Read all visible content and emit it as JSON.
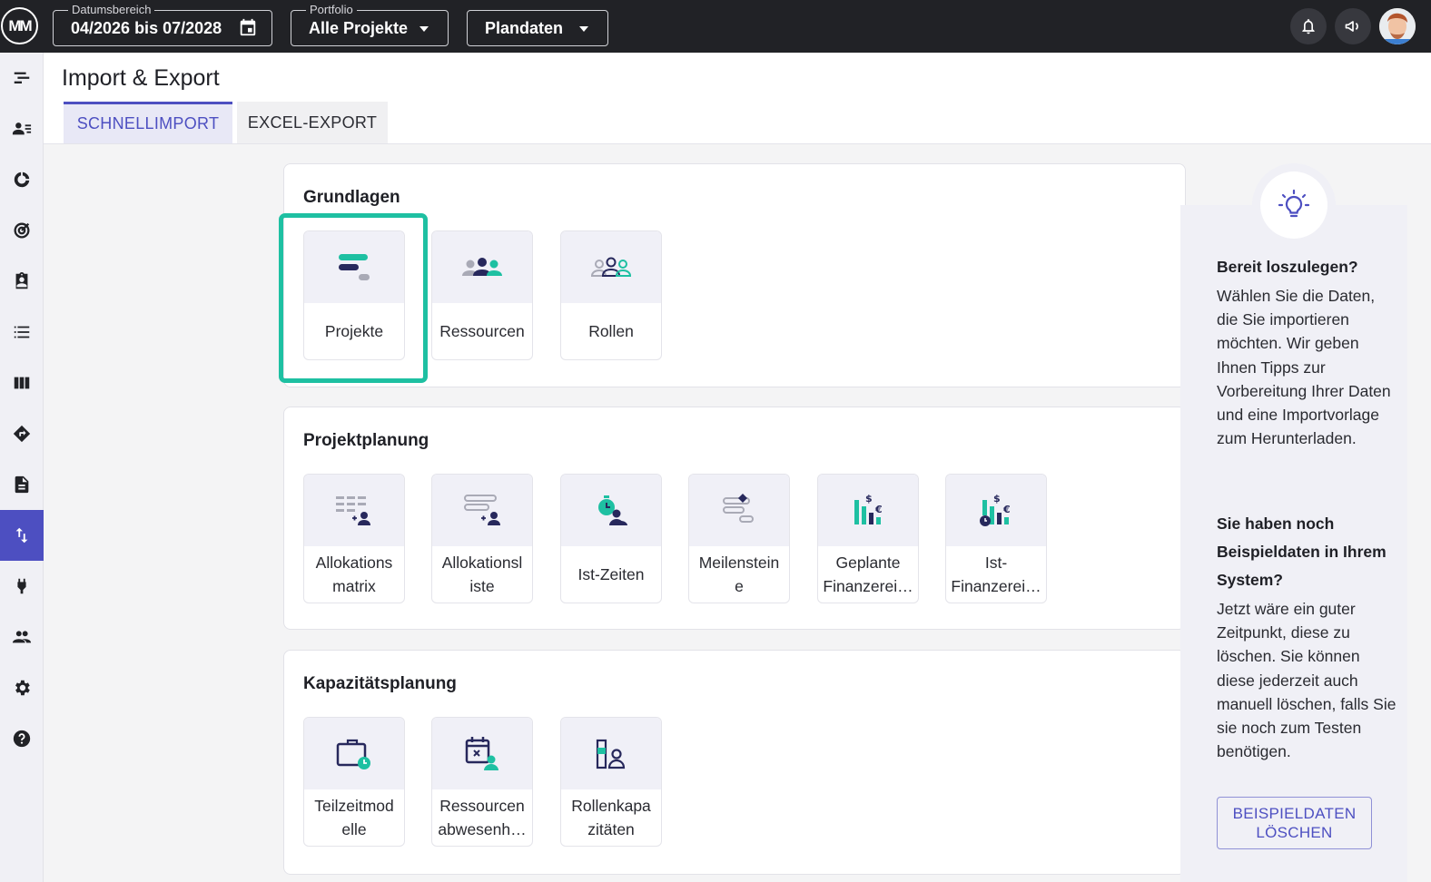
{
  "colors": {
    "accent": "#4d4fc1",
    "teal": "#1ec0a2",
    "navy": "#27285c",
    "topbar": "#212226"
  },
  "topbar": {
    "logo_text": "MM",
    "date_range": {
      "legend": "Datumsbereich",
      "value": "04/2026 bis 07/2028"
    },
    "portfolio": {
      "legend": "Portfolio",
      "value": "Alle Projekte"
    },
    "data_type": {
      "value": "Plandaten"
    }
  },
  "sidebar": {
    "items": [
      {
        "icon": "gantt-icon"
      },
      {
        "icon": "resource-list-icon"
      },
      {
        "icon": "pie-chart-icon"
      },
      {
        "icon": "target-icon"
      },
      {
        "icon": "clipboard-person-icon"
      },
      {
        "icon": "list-icon"
      },
      {
        "icon": "columns-icon"
      },
      {
        "icon": "direction-sign-icon"
      },
      {
        "icon": "document-icon"
      },
      {
        "icon": "import-export-icon",
        "active": true
      },
      {
        "icon": "plug-icon"
      },
      {
        "icon": "people-icon"
      },
      {
        "icon": "gear-icon"
      },
      {
        "icon": "help-icon"
      }
    ]
  },
  "header": {
    "title": "Import & Export",
    "tabs": [
      {
        "label": "SCHNELLIMPORT",
        "active": true
      },
      {
        "label": "EXCEL-EXPORT"
      }
    ]
  },
  "sections": [
    {
      "title": "Grundlagen",
      "tiles": [
        {
          "label": "Projekte"
        },
        {
          "label": "Ressourcen"
        },
        {
          "label": "Rollen"
        }
      ]
    },
    {
      "title": "Projektplanung",
      "tiles": [
        {
          "label": "Allokations matrix"
        },
        {
          "label": "Allokationsl iste"
        },
        {
          "label": "Ist-Zeiten"
        },
        {
          "label": "Meilenstein e"
        },
        {
          "label": "Geplante Finanzerei…"
        },
        {
          "label": "Ist-Finanzerei…"
        }
      ]
    },
    {
      "title": "Kapazitätsplanung",
      "tiles": [
        {
          "label": "Teilzeitmod elle"
        },
        {
          "label": "Ressourcen abwesenh…"
        },
        {
          "label": "Rollenkapa zitäten"
        }
      ]
    }
  ],
  "tips": {
    "heading1": "Bereit loszulegen?",
    "text1": "Wählen Sie die Daten, die Sie importieren möchten. Wir geben Ihnen Tipps zur Vorbereitung Ihrer Daten und eine Importvorlage zum Herunterladen.",
    "heading2": "Sie haben noch Beispieldaten in Ihrem System?",
    "text2": "Jetzt wäre ein guter Zeitpunkt, diese zu löschen. Sie können diese jederzeit auch manuell löschen, falls Sie sie noch zum Testen benötigen.",
    "button": "BEISPIELDATEN LÖSCHEN"
  }
}
